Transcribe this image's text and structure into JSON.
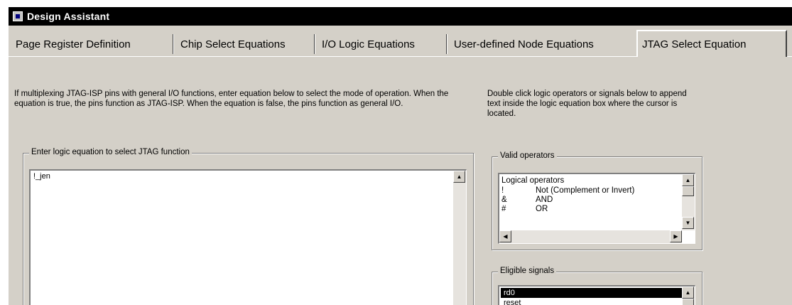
{
  "window": {
    "title": "Design Assistant",
    "icon": "app-icon"
  },
  "tabs": [
    {
      "label": "Page Register Definition"
    },
    {
      "label": "Chip Select Equations"
    },
    {
      "label": "I/O Logic Equations"
    },
    {
      "label": "User-defined Node Equations"
    },
    {
      "label": "JTAG Select Equation",
      "active": true
    }
  ],
  "left_description": "If multiplexing JTAG-ISP pins with general I/O functions, enter equation below to select the mode of operation. When the equation is true, the pins function as JTAG-ISP. When the equation is false, the pins function as general I/O.",
  "right_description": "Double click logic operators or signals below to append text inside the logic equation box where the cursor is located.",
  "equation_group": {
    "label": "Enter logic equation to select JTAG function",
    "value": "!_jen"
  },
  "operators_group": {
    "label": "Valid operators",
    "header": "Logical operators",
    "items": [
      {
        "symbol": "!",
        "description": "Not (Complement or Invert)"
      },
      {
        "symbol": "&",
        "description": "AND"
      },
      {
        "symbol": "#",
        "description": "OR"
      }
    ]
  },
  "signals_group": {
    "label": "Eligible signals",
    "items": [
      {
        "label": "rd0",
        "selected": true
      },
      {
        "label": "reset",
        "selected": false
      }
    ]
  }
}
